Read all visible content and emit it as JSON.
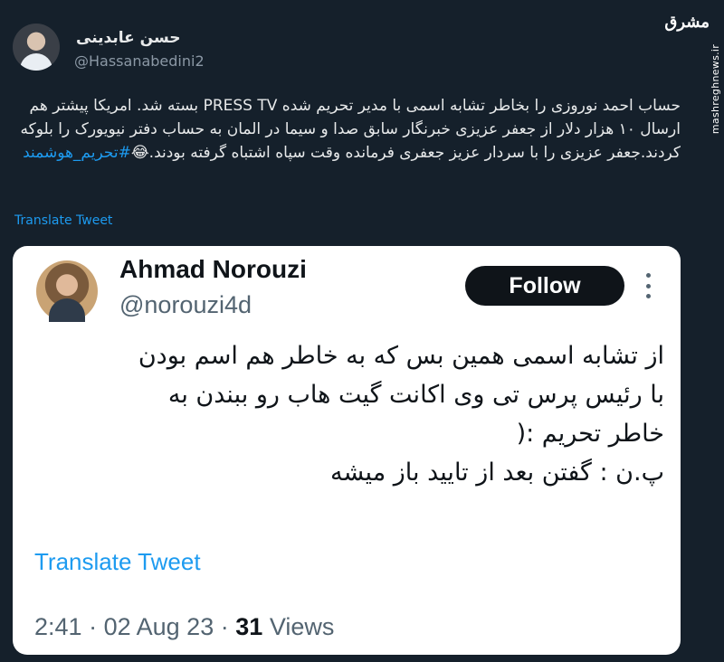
{
  "outer": {
    "author_name": "حسن عابدینی",
    "handle": "@Hassanabedini2",
    "text_main": "حساب احمد نوروزی را بخاطر تشابه اسمی با مدیر تحریم شده PRESS TV بسته شد. امریکا پیشتر هم ارسال ۱۰ هزار دلار از جعفر عزیزی خبرنگار سابق صدا و سیما در المان به حساب دفتر نیویورک را بلوکه کردند.جعفر عزیزی را با سردار عزیز جعفری فرمانده وقت سپاه اشتباه گرفته بودند.😂",
    "hashtag": "#تحریم_هوشمند",
    "translate_label": "Translate Tweet"
  },
  "brand": {
    "logo_text": "مشرق",
    "url_text": "mashreghnews.ir"
  },
  "card": {
    "name": "Ahmad Norouzi",
    "handle": "@norouzi4d",
    "follow_label": "Follow",
    "text_lines": [
      "از تشابه اسمی همین بس که به خاطر هم اسم بودن",
      "با رئیس پرس تی وی اکانت گیت هاب رو ببندن به",
      "خاطر تحریم :(",
      "پ.ن : گفتن بعد از تایید باز میشه"
    ],
    "translate_label": "Translate Tweet",
    "time": "2:41",
    "date": "02 Aug 23",
    "views_count": "31",
    "views_label": "Views",
    "separator": "·"
  },
  "colors": {
    "background": "#15202b",
    "link": "#1d9bf0",
    "card_bg": "#ffffff",
    "follow_bg": "#0f1419"
  }
}
